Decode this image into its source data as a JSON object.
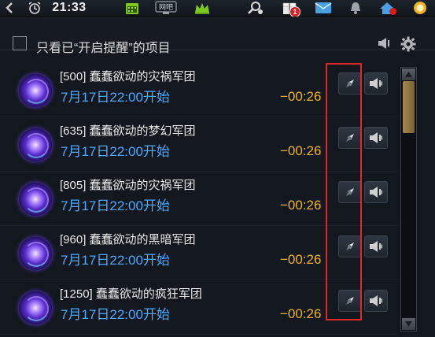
{
  "statusbar": {
    "time": "21:33",
    "app_label": "网吧",
    "notif_count": "1"
  },
  "filter": {
    "label": "只看已“开启提醒”的项目"
  },
  "events": [
    {
      "title": "[500] 蠢蠢欲动的灾祸军团",
      "start": "7月17日22:00开始",
      "countdown": "−00:26"
    },
    {
      "title": "[635] 蠢蠢欲动的梦幻军团",
      "start": "7月17日22:00开始",
      "countdown": "−00:26"
    },
    {
      "title": "[805] 蠢蠢欲动的灾祸军团",
      "start": "7月17日22:00开始",
      "countdown": "−00:26"
    },
    {
      "title": "[960] 蠢蠢欲动的黑暗军团",
      "start": "7月17日22:00开始",
      "countdown": "−00:26"
    },
    {
      "title": "[1250] 蠢蠢欲动的疯狂军团",
      "start": "7月17日22:00开始",
      "countdown": "−00:26"
    }
  ],
  "colors": {
    "countdown": "#f0b418",
    "start": "#4aa8ff",
    "highlight": "#e02626"
  }
}
